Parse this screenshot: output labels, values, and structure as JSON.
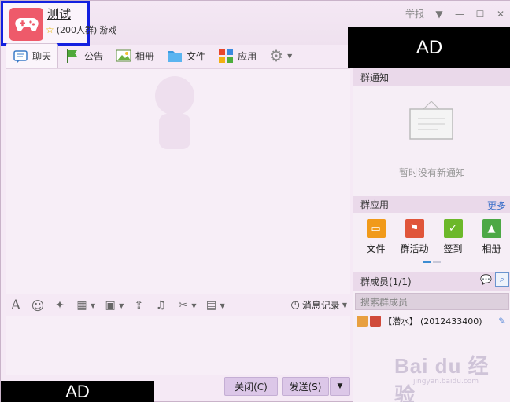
{
  "window": {
    "group_name": "测试",
    "member_count_text": "(200人群)",
    "category": "游戏",
    "report_label": "举报"
  },
  "tabs": [
    {
      "label": "聊天",
      "icon": "chat-bubble-icon"
    },
    {
      "label": "公告",
      "icon": "flag-icon"
    },
    {
      "label": "相册",
      "icon": "photo-icon"
    },
    {
      "label": "文件",
      "icon": "folder-icon"
    },
    {
      "label": "应用",
      "icon": "apps-grid-icon"
    }
  ],
  "ads": {
    "top": "AD",
    "bottom": "AD"
  },
  "input_toolbar": {
    "history_label": "消息记录"
  },
  "buttons": {
    "close": "关闭(C)",
    "send": "发送(S)"
  },
  "panel": {
    "notice_title": "群通知",
    "notice_empty": "暂时没有新通知",
    "apps_title": "群应用",
    "more_label": "更多",
    "apps": [
      {
        "label": "文件",
        "color": "#f19a1a"
      },
      {
        "label": "群活动",
        "color": "#e0553a"
      },
      {
        "label": "签到",
        "color": "#6cb82a"
      },
      {
        "label": "相册",
        "color": "#4ca845"
      }
    ],
    "members_title": "群成员(1/1)",
    "member_search_placeholder": "搜索群成员",
    "members": [
      {
        "role": "【潜水】",
        "id": "(2012433400)"
      }
    ]
  },
  "watermark": {
    "brand": "Bai du 经验",
    "url": "jingyan.baidu.com"
  }
}
